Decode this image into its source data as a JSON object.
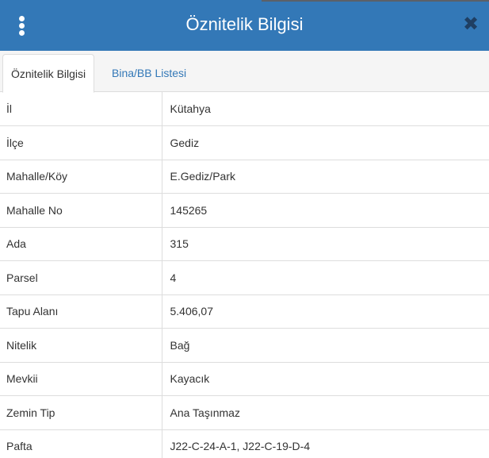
{
  "header": {
    "title": "Öznitelik Bilgisi",
    "menu_icon": "vertical-ellipsis-icon",
    "close_icon": "close-icon",
    "close_glyph": "✖",
    "color": "#3378b7"
  },
  "tabs": [
    {
      "label": "Öznitelik Bilgisi",
      "active": true
    },
    {
      "label": "Bina/BB Listesi",
      "active": false
    }
  ],
  "attributes": [
    {
      "key": "İl",
      "value": "Kütahya"
    },
    {
      "key": "İlçe",
      "value": "Gediz"
    },
    {
      "key": "Mahalle/Köy",
      "value": "E.Gediz/Park"
    },
    {
      "key": "Mahalle No",
      "value": "145265"
    },
    {
      "key": "Ada",
      "value": "315"
    },
    {
      "key": "Parsel",
      "value": "4"
    },
    {
      "key": "Tapu Alanı",
      "value": "5.406,07"
    },
    {
      "key": "Nitelik",
      "value": "Bağ"
    },
    {
      "key": "Mevkii",
      "value": "Kayacık"
    },
    {
      "key": "Zemin Tip",
      "value": "Ana Taşınmaz"
    },
    {
      "key": "Pafta",
      "value": "J22-C-24-A-1, J22-C-19-D-4"
    }
  ]
}
